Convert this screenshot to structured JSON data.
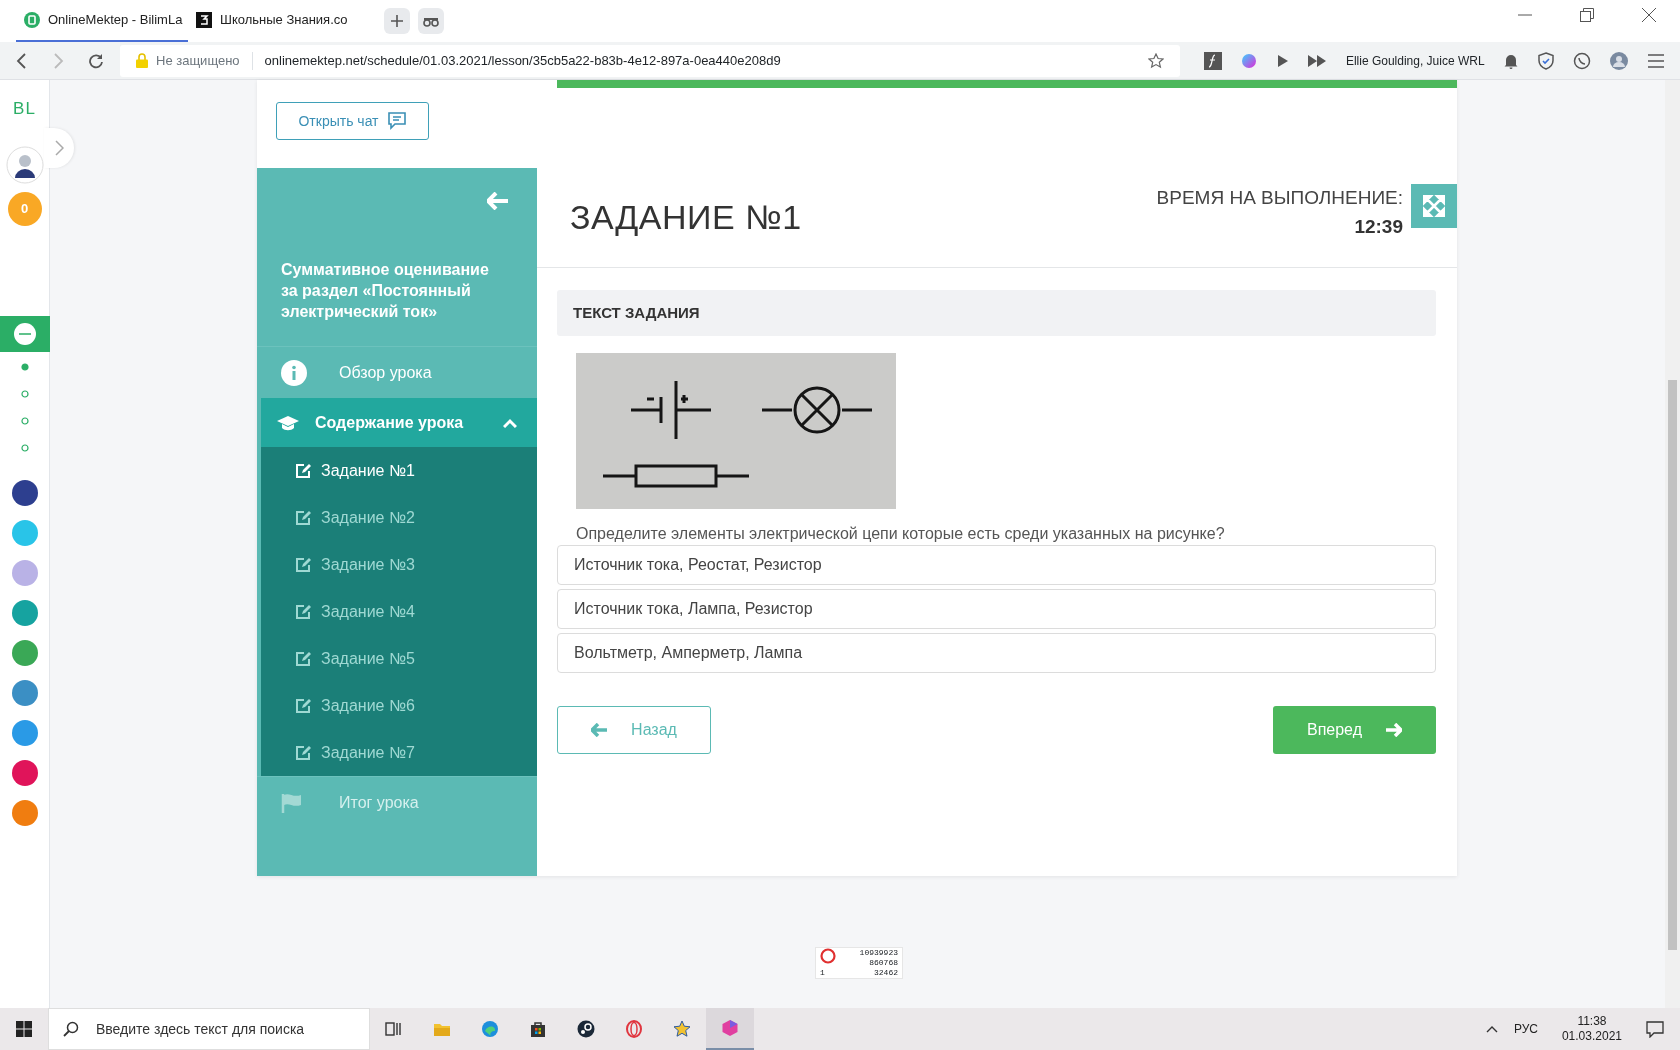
{
  "browser": {
    "tabs": [
      {
        "title": "OnlineMektep - BilimLa",
        "selected": true
      },
      {
        "title": "Школьные Знания.co",
        "selected": false
      }
    ],
    "security": "Не защищено",
    "url": "onlinemektep.net/schedule/01.03.2021/lesson/35cb5a22-b83b-4e12-897a-0ea440e208d9",
    "now_playing": "Ellie Goulding, Juice WRL"
  },
  "rail": {
    "logo": "BL",
    "coins": "0",
    "nav_dots": [
      {
        "selected": true
      },
      {
        "selected": false
      },
      {
        "selected": false
      },
      {
        "selected": false
      }
    ],
    "apps": [
      {
        "color": "#2d3f8f"
      },
      {
        "color": "#29c4e8"
      },
      {
        "color": "#b9b2e6"
      },
      {
        "color": "#16a3a0"
      },
      {
        "color": "#3aa856"
      },
      {
        "color": "#3b8fc4"
      },
      {
        "color": "#2a9ae6"
      },
      {
        "color": "#e0145a"
      },
      {
        "color": "#f07d10"
      }
    ]
  },
  "chat_button": "Открыть чат",
  "lesson": {
    "title": "Суммативное оценивание за раздел «Постоянный электрический ток»",
    "menu": [
      {
        "kind": "overview",
        "label": "Обзор урока",
        "disabled": false
      },
      {
        "kind": "section",
        "label": "Содержание урока",
        "expanded": true,
        "children": [
          {
            "label": "Задание №1",
            "selected": true
          },
          {
            "label": "Задание №2",
            "selected": false
          },
          {
            "label": "Задание №3",
            "selected": false
          },
          {
            "label": "Задание №4",
            "selected": false
          },
          {
            "label": "Задание №5",
            "selected": false
          },
          {
            "label": "Задание №6",
            "selected": false
          },
          {
            "label": "Задание №7",
            "selected": false
          }
        ]
      },
      {
        "kind": "summary",
        "label": "Итог урока",
        "disabled": true
      }
    ]
  },
  "task": {
    "heading": "ЗАДАНИЕ №1",
    "time_label": "ВРЕМЯ НА ВЫПОЛНЕНИЕ:",
    "time": "12:39",
    "section_title": "ТЕКСТ ЗАДАНИЯ",
    "question": "Определите элементы электрической цепи которые есть среди указанных на рисунке?",
    "options": [
      {
        "text": "Источник тока, Реостат, Резистор",
        "selected": false
      },
      {
        "text": "Источник тока, Лампа, Резистор",
        "selected": false
      },
      {
        "text": "Вольтметр, Амперметр, Лампа",
        "selected": false
      }
    ],
    "back": "Назад",
    "next": "Вперед"
  },
  "counter": {
    "values": [
      "10939923",
      "860768",
      "32462"
    ],
    "count": "1"
  },
  "taskbar": {
    "search_placeholder": "Введите здесь текст для поиска",
    "language": "РУС",
    "time": "11:38",
    "date": "01.03.2021"
  }
}
